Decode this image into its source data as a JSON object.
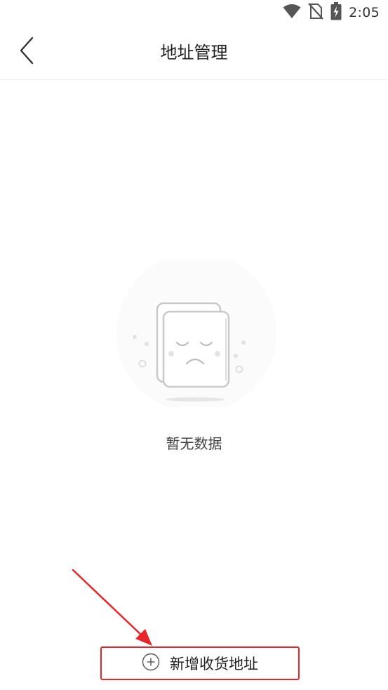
{
  "status_bar": {
    "time": "2:05",
    "icons": [
      "wifi-icon",
      "no-sim-icon",
      "battery-charging-icon"
    ]
  },
  "header": {
    "title": "地址管理",
    "back_icon": "chevron-left-icon"
  },
  "empty_state": {
    "illustration": "sad-document-icon",
    "message": "暂无数据"
  },
  "footer": {
    "add_address_label": "新增收货地址",
    "add_icon": "plus-circle-icon"
  },
  "colors": {
    "annotation": "#e8262a",
    "text_primary": "#222222",
    "divider": "#eeeeee"
  }
}
